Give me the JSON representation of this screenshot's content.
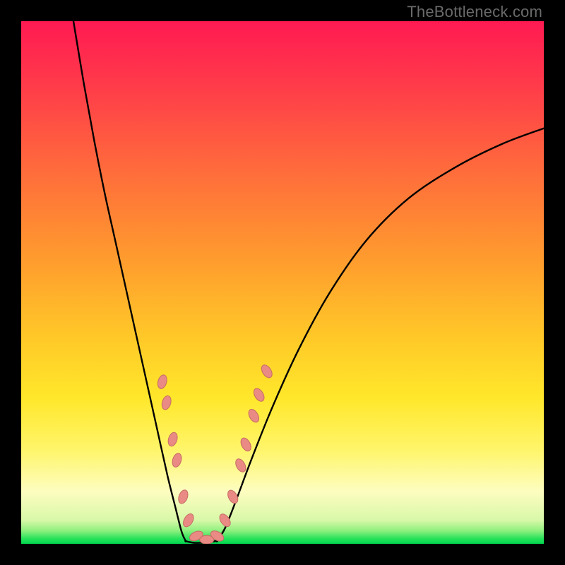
{
  "watermark": "TheBottleneck.com",
  "colors": {
    "page_bg": "#000000",
    "curve": "#000000",
    "pill_fill": "#e98b84",
    "pill_stroke": "#c76b64",
    "gradient_stops": [
      {
        "offset": 0.0,
        "color": "#ff1a52"
      },
      {
        "offset": 0.12,
        "color": "#ff3a4a"
      },
      {
        "offset": 0.28,
        "color": "#ff6a3c"
      },
      {
        "offset": 0.45,
        "color": "#ff9a2e"
      },
      {
        "offset": 0.6,
        "color": "#ffc728"
      },
      {
        "offset": 0.72,
        "color": "#ffe72a"
      },
      {
        "offset": 0.82,
        "color": "#fff56a"
      },
      {
        "offset": 0.9,
        "color": "#fdfdc0"
      },
      {
        "offset": 0.955,
        "color": "#d8f8a8"
      },
      {
        "offset": 0.975,
        "color": "#8ef07e"
      },
      {
        "offset": 0.99,
        "color": "#28e25a"
      },
      {
        "offset": 1.0,
        "color": "#00d850"
      }
    ]
  },
  "chart_data": {
    "type": "line",
    "title": "",
    "xlabel": "",
    "ylabel": "",
    "x_range": [
      0,
      100
    ],
    "y_range": [
      0,
      100
    ],
    "series": [
      {
        "name": "left-descent",
        "x": [
          10,
          12,
          14,
          16,
          18,
          20,
          22,
          24,
          26,
          28,
          29.5,
          30.5,
          31,
          31.5
        ],
        "y": [
          100,
          88,
          77,
          67,
          58,
          49,
          40,
          31,
          22,
          13,
          7,
          3,
          1.5,
          0.5
        ]
      },
      {
        "name": "valley-floor",
        "x": [
          31.5,
          33,
          34.5,
          36,
          37.5
        ],
        "y": [
          0.5,
          0.2,
          0.2,
          0.3,
          0.6
        ]
      },
      {
        "name": "right-ascent",
        "x": [
          37.5,
          39,
          41,
          44,
          48,
          53,
          59,
          66,
          74,
          83,
          92,
          100
        ],
        "y": [
          0.6,
          3,
          8,
          16,
          26,
          37,
          48,
          58,
          66,
          72,
          76.5,
          79.5
        ]
      }
    ],
    "markers": {
      "name": "highlight-pills",
      "points": [
        {
          "x": 27.0,
          "y": 31.0,
          "angle": -74
        },
        {
          "x": 27.8,
          "y": 27.0,
          "angle": -74
        },
        {
          "x": 29.0,
          "y": 20.0,
          "angle": -73
        },
        {
          "x": 29.8,
          "y": 16.0,
          "angle": -73
        },
        {
          "x": 31.0,
          "y": 9.0,
          "angle": -70
        },
        {
          "x": 32.0,
          "y": 4.5,
          "angle": -60
        },
        {
          "x": 33.5,
          "y": 1.5,
          "angle": -25
        },
        {
          "x": 35.5,
          "y": 0.8,
          "angle": 0
        },
        {
          "x": 37.5,
          "y": 1.5,
          "angle": 30
        },
        {
          "x": 39.0,
          "y": 4.5,
          "angle": 55
        },
        {
          "x": 40.5,
          "y": 9.0,
          "angle": 62
        },
        {
          "x": 42.0,
          "y": 15.0,
          "angle": 62
        },
        {
          "x": 43.0,
          "y": 19.0,
          "angle": 62
        },
        {
          "x": 44.5,
          "y": 24.5,
          "angle": 60
        },
        {
          "x": 45.5,
          "y": 28.5,
          "angle": 59
        },
        {
          "x": 47.0,
          "y": 33.0,
          "angle": 57
        }
      ],
      "pill_rx": 10,
      "pill_ry": 6
    }
  }
}
